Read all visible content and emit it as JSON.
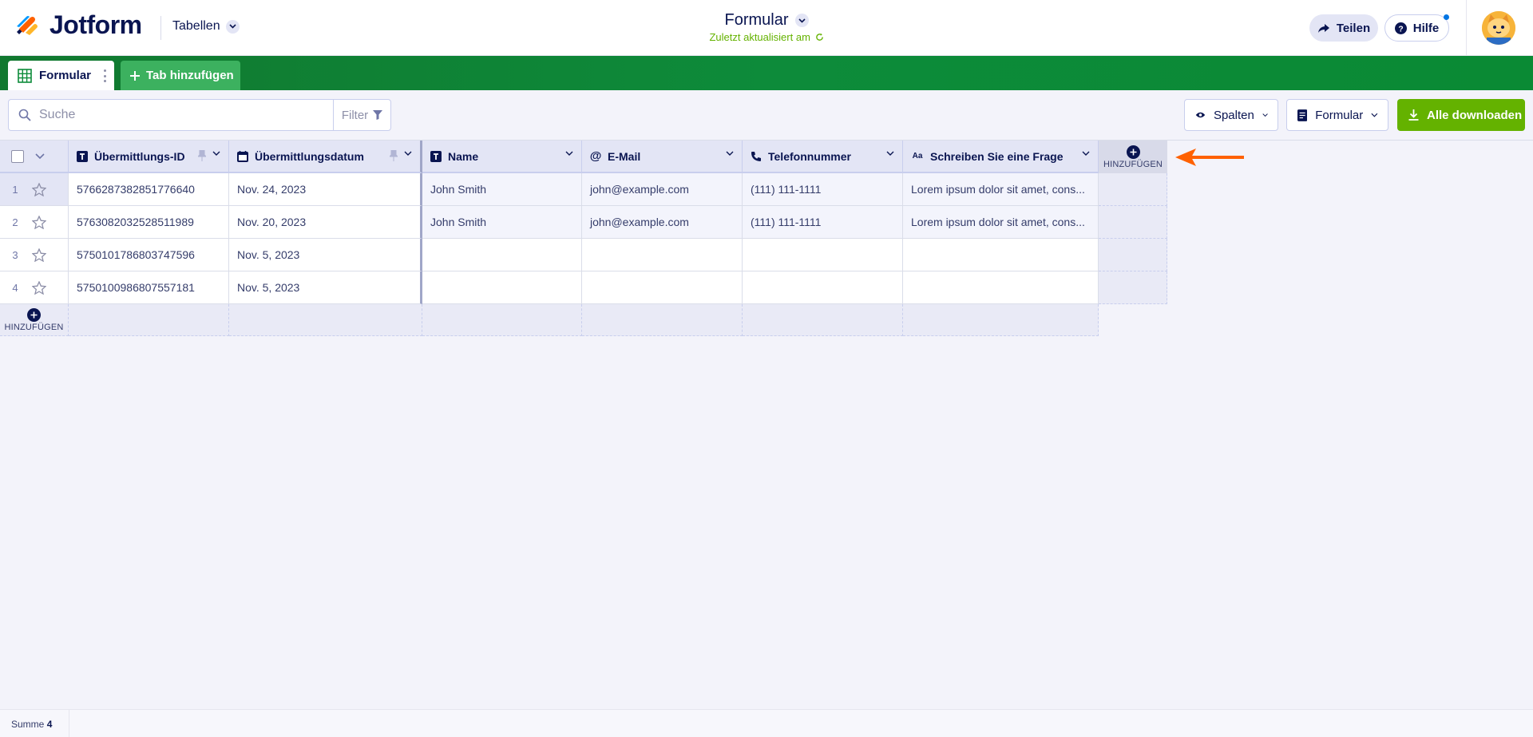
{
  "app": {
    "brand": "Jotform",
    "tables_label": "Tabellen"
  },
  "form": {
    "title": "Formular",
    "updated": "Zuletzt aktualisiert am"
  },
  "header": {
    "share_label": "Teilen",
    "help_label": "Hilfe"
  },
  "tabs": {
    "active_label": "Formular",
    "add_label": "Tab hinzufügen"
  },
  "toolbar": {
    "search_placeholder": "Suche",
    "filter_label": "Filter",
    "columns_label": "Spalten",
    "form_label": "Formular",
    "download_label": "Alle downloaden"
  },
  "table": {
    "columns": [
      {
        "label": "Übermittlungs-ID",
        "type_icon": "text-field-icon",
        "pinned": true
      },
      {
        "label": "Übermittlungsdatum",
        "type_icon": "calendar-icon",
        "pinned": true
      },
      {
        "label": "Name",
        "type_icon": "text-field-icon",
        "pinned": false
      },
      {
        "label": "E-Mail",
        "type_icon": "at-sign-icon",
        "pinned": false
      },
      {
        "label": "Telefonnummer",
        "type_icon": "phone-icon",
        "pinned": false
      },
      {
        "label": "Schreiben Sie eine Frage",
        "type_icon": "long-text-icon",
        "pinned": false
      }
    ],
    "add_label": "HINZUFÜGEN",
    "rows": [
      {
        "num": "1",
        "id": "5766287382851776640",
        "date": "Nov. 24, 2023",
        "name": "John Smith",
        "email": "john@example.com",
        "phone": "(111) 111-1111",
        "question": "Lorem ipsum dolor sit amet, cons..."
      },
      {
        "num": "2",
        "id": "5763082032528511989",
        "date": "Nov. 20, 2023",
        "name": "John Smith",
        "email": "john@example.com",
        "phone": "(111) 111-1111",
        "question": "Lorem ipsum dolor sit amet, cons..."
      },
      {
        "num": "3",
        "id": "5750101786803747596",
        "date": "Nov. 5, 2023",
        "name": "",
        "email": "",
        "phone": "",
        "question": ""
      },
      {
        "num": "4",
        "id": "5750100986807557181",
        "date": "Nov. 5, 2023",
        "name": "",
        "email": "",
        "phone": "",
        "question": ""
      }
    ]
  },
  "footer": {
    "sum_label": "Summe",
    "sum_value": "4"
  },
  "colors": {
    "green": "#0d8b3a",
    "download": "#64b200",
    "arrow": "#ff6100",
    "navy": "#0a1551"
  }
}
